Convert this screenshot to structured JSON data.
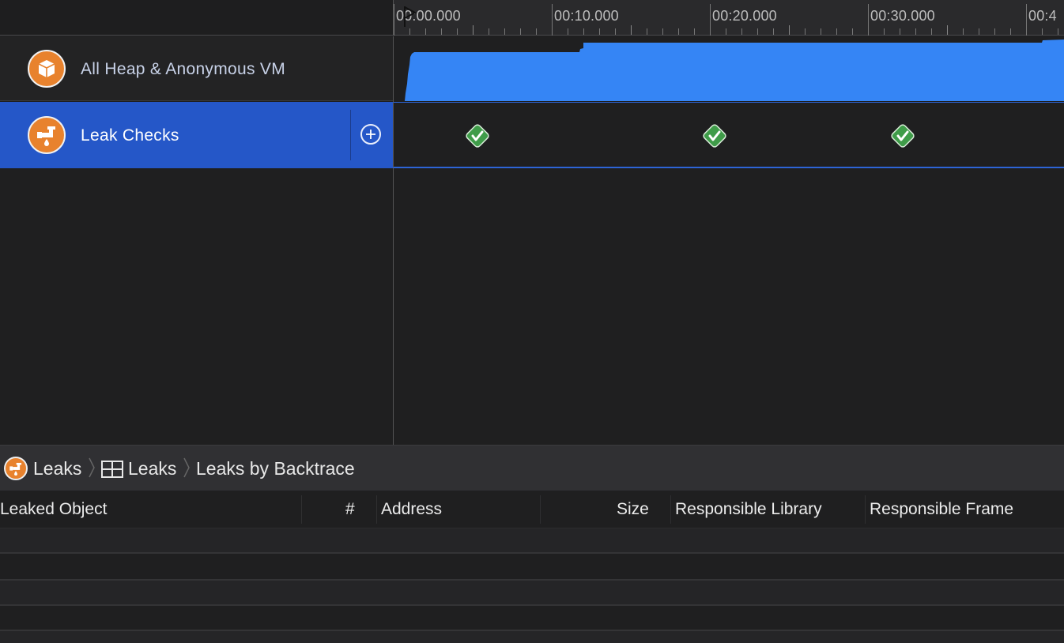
{
  "timeline": {
    "ruler_labels": [
      "00:00.000",
      "00:10.000",
      "00:20.000",
      "00:30.000",
      "00:4"
    ],
    "playhead_icon": "flag-icon"
  },
  "tracks": [
    {
      "title": "All Heap & Anonymous VM",
      "icon": "cube-icon",
      "graph_color": "#3585f5",
      "selected": false
    },
    {
      "title": "Leak Checks",
      "icon": "leaking-pipe-icon",
      "marker_color": "#3f9c49",
      "selected": true,
      "add_icon": "plus-circle-icon"
    }
  ],
  "breadcrumb": {
    "items": [
      "Leaks",
      "Leaks",
      "Leaks by Backtrace"
    ],
    "icons": [
      "leaking-pipe-icon",
      "table-icon"
    ]
  },
  "table": {
    "columns": [
      "Leaked Object",
      "#",
      "Address",
      "Size",
      "Responsible Library",
      "Responsible Frame"
    ],
    "rows": []
  },
  "colors": {
    "accent": "#2557c8",
    "instrument_orange": "#e8822d",
    "check_green": "#3f9c49"
  }
}
